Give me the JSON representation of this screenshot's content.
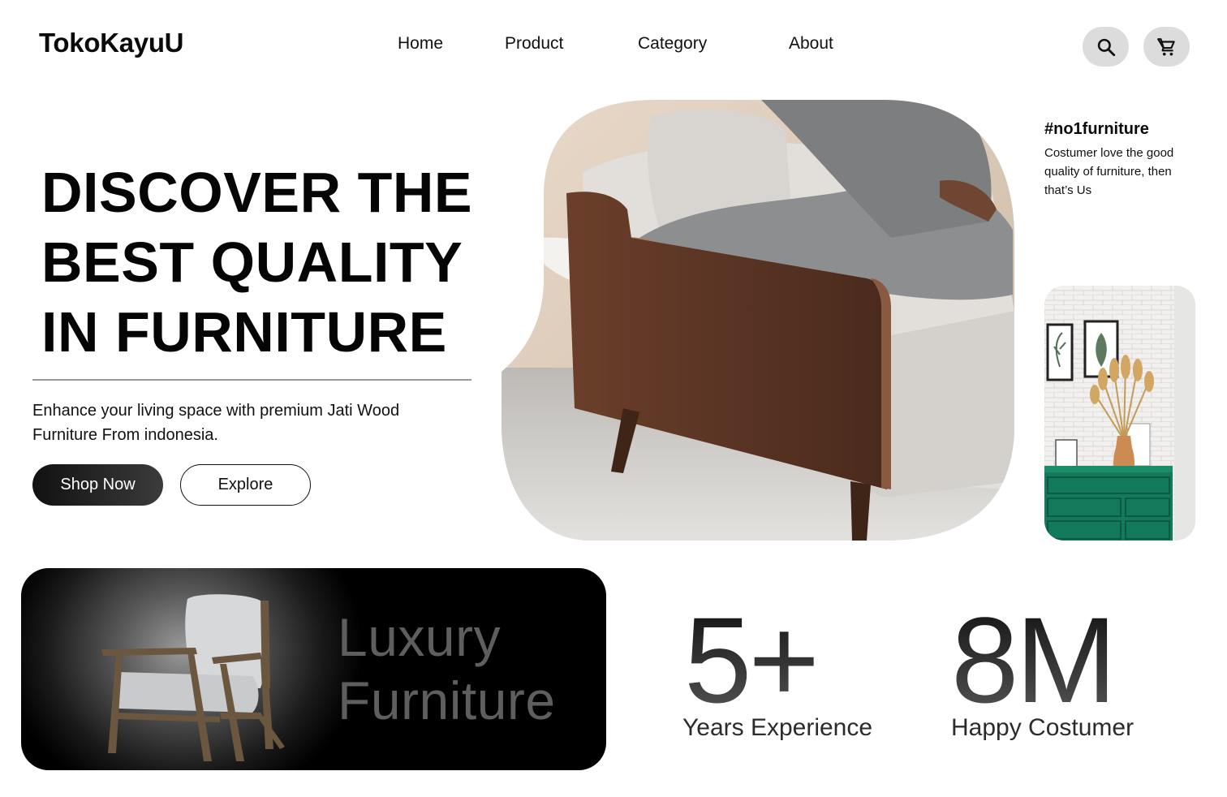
{
  "header": {
    "logo": "TokoKayuU",
    "nav": [
      "Home",
      "Product",
      "Category",
      "About"
    ],
    "icons": [
      "search-icon",
      "cart-icon"
    ]
  },
  "hero": {
    "title_lines": [
      "DISCOVER THE",
      "BEST QUALITY",
      "IN FURNITURE"
    ],
    "description": "Enhance your living space with premium Jati Wood Furniture From indonesia.",
    "primary_button": "Shop Now",
    "secondary_button": "Explore"
  },
  "highlight": {
    "tag": "#no1furniture",
    "text": "Costumer love the good quality of furniture, then that’s Us"
  },
  "banner": {
    "line1": "Luxury",
    "line2": "Furniture"
  },
  "stats": [
    {
      "value": "5+",
      "label": "Years Experience"
    },
    {
      "value": "8M",
      "label": "Happy Costumer"
    }
  ],
  "colors": {
    "primary_button": "#111111",
    "icon_button_bg": "#dcdcdc",
    "dresser_green": "#127a5a",
    "walnut": "#5a3424"
  }
}
